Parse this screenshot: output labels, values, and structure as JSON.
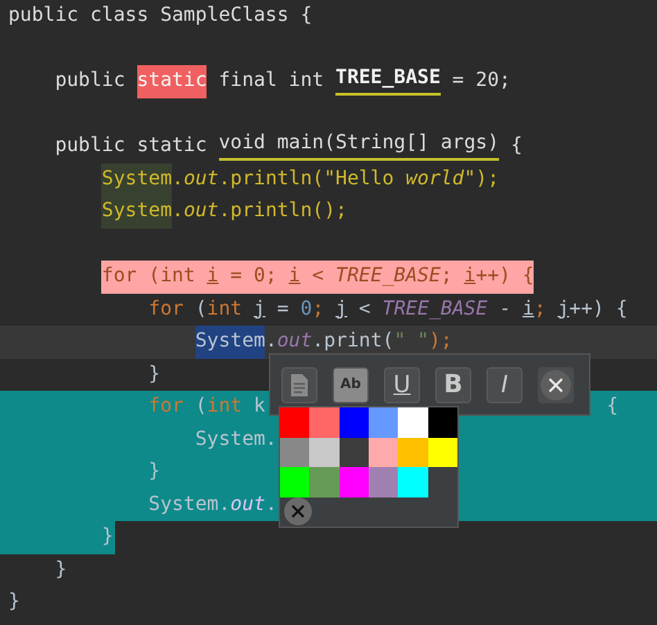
{
  "editor": {
    "lines": [
      {
        "kind": "code",
        "tokens": [
          {
            "text": "public class SampleClass {",
            "kind": "plain"
          }
        ],
        "children": [
          {
            "kind": "blank"
          },
          {
            "kind": "code",
            "tokens": [
              {
                "text": "public ",
                "kind": "plain"
              },
              {
                "text": "static",
                "kind": "redbox"
              },
              {
                "text": " final int ",
                "kind": "plain"
              },
              {
                "text": "TREE_BASE",
                "kind": "decl"
              },
              {
                "text": " = 20;",
                "kind": "plain"
              }
            ]
          },
          {
            "kind": "blank"
          },
          {
            "kind": "code",
            "tokens": [
              {
                "text": "public static ",
                "kind": "plain"
              },
              {
                "text": "void main(String[] args)",
                "kind": "under"
              },
              {
                "text": " {",
                "kind": "plain"
              }
            ],
            "children": [
              {
                "kind": "code",
                "tokens": [
                  {
                    "text": "System",
                    "kind": "ysys"
                  },
                  {
                    "text": ".",
                    "kind": "yellow"
                  },
                  {
                    "text": "out",
                    "kind": "yitalic"
                  },
                  {
                    "text": ".println(\"Hello ",
                    "kind": "yellow"
                  },
                  {
                    "text": "world",
                    "kind": "yitalic"
                  },
                  {
                    "text": "\");",
                    "kind": "yellow"
                  }
                ]
              },
              {
                "kind": "code",
                "tokens": [
                  {
                    "text": "System",
                    "kind": "ysys"
                  },
                  {
                    "text": ".",
                    "kind": "yellow"
                  },
                  {
                    "text": "out",
                    "kind": "yitalic"
                  },
                  {
                    "text": ".println();",
                    "kind": "yellow"
                  }
                ]
              },
              {
                "kind": "blank"
              },
              {
                "kind": "code",
                "marked": true,
                "tokens": [
                  {
                    "text": "for (int ",
                    "kind": "faded"
                  },
                  {
                    "text": "i",
                    "kind": "fadedu"
                  },
                  {
                    "text": " = 0; ",
                    "kind": "faded"
                  },
                  {
                    "text": "i",
                    "kind": "fadedu"
                  },
                  {
                    "text": " < ",
                    "kind": "faded"
                  },
                  {
                    "text": "TREE_BASE",
                    "kind": "fadedi"
                  },
                  {
                    "text": "; ",
                    "kind": "faded"
                  },
                  {
                    "text": "i",
                    "kind": "fadedu"
                  },
                  {
                    "text": "++) {",
                    "kind": "faded"
                  }
                ],
                "children": [
                  {
                    "kind": "code",
                    "tokens": [
                      {
                        "text": "for",
                        "kind": "kw"
                      },
                      {
                        "text": " (",
                        "kind": "text"
                      },
                      {
                        "text": "int ",
                        "kind": "kw"
                      },
                      {
                        "text": "j",
                        "kind": "var"
                      },
                      {
                        "text": " = ",
                        "kind": "text"
                      },
                      {
                        "text": "0",
                        "kind": "num"
                      },
                      {
                        "text": "; ",
                        "kind": "kw"
                      },
                      {
                        "text": "j",
                        "kind": "var"
                      },
                      {
                        "text": " < ",
                        "kind": "text"
                      },
                      {
                        "text": "TREE_BASE",
                        "kind": "const"
                      },
                      {
                        "text": " - ",
                        "kind": "text"
                      },
                      {
                        "text": "i",
                        "kind": "var"
                      },
                      {
                        "text": "; ",
                        "kind": "kw"
                      },
                      {
                        "text": "j",
                        "kind": "var"
                      },
                      {
                        "text": "++) {",
                        "kind": "text"
                      }
                    ],
                    "children": [
                      {
                        "kind": "code",
                        "current": true,
                        "tokens": [
                          {
                            "text": "System",
                            "kind": "selected"
                          },
                          {
                            "text": ".",
                            "kind": "text"
                          },
                          {
                            "text": "out",
                            "kind": "const"
                          },
                          {
                            "text": ".print(",
                            "kind": "text"
                          },
                          {
                            "text": "\" \"",
                            "kind": "str"
                          },
                          {
                            "text": ");",
                            "kind": "kw"
                          }
                        ]
                      }
                    ]
                  },
                  {
                    "kind": "code",
                    "tokens": [
                      {
                        "text": "}",
                        "kind": "text"
                      }
                    ]
                  },
                  {
                    "kind": "code",
                    "selected": true,
                    "tokens": [
                      {
                        "text": "for",
                        "kind": "kw"
                      },
                      {
                        "text": " (",
                        "kind": "text"
                      },
                      {
                        "text": "int ",
                        "kind": "kw"
                      },
                      {
                        "text": "k",
                        "kind": "text"
                      },
                      {
                        "text": "{",
                        "kind": "tail"
                      }
                    ],
                    "children": [
                      {
                        "kind": "code",
                        "selected": true,
                        "tokens": [
                          {
                            "text": "System.",
                            "kind": "text"
                          }
                        ]
                      }
                    ]
                  },
                  {
                    "kind": "code",
                    "selected": true,
                    "tokens": [
                      {
                        "text": "}",
                        "kind": "text"
                      }
                    ]
                  },
                  {
                    "kind": "code",
                    "selected": true,
                    "tokens": [
                      {
                        "text": "System.",
                        "kind": "text"
                      },
                      {
                        "text": "out",
                        "kind": "const"
                      },
                      {
                        "text": ".",
                        "kind": "text"
                      }
                    ]
                  }
                ]
              },
              {
                "kind": "code",
                "selected": true,
                "tokens": [
                  {
                    "text": "}",
                    "kind": "text"
                  }
                ]
              }
            ]
          },
          {
            "kind": "code",
            "tokens": [
              {
                "text": "}",
                "kind": "text"
              }
            ]
          }
        ]
      },
      {
        "kind": "code",
        "tokens": [
          {
            "text": "}",
            "kind": "text"
          }
        ]
      }
    ]
  },
  "popup": {
    "tools": [
      {
        "kind": "copy"
      },
      {
        "kind": "text",
        "label": "Ab"
      },
      {
        "kind": "underline",
        "label": "U"
      },
      {
        "kind": "bold",
        "label": "B"
      },
      {
        "kind": "italic",
        "label": "I"
      },
      {
        "kind": "close"
      }
    ],
    "swatches": [
      {
        "color": "#ff0000"
      },
      {
        "color": "#ff6666"
      },
      {
        "color": "#0000ff"
      },
      {
        "color": "#6699ff"
      },
      {
        "color": "#ffffff"
      },
      {
        "color": "#000000"
      },
      {
        "color": "#888888"
      },
      {
        "color": "#c8c8c8"
      },
      {
        "color": "#3c3c3c"
      },
      {
        "color": "#ffaaaa"
      },
      {
        "color": "#ffc000"
      },
      {
        "color": "#ffff00"
      },
      {
        "color": "#00ff00"
      },
      {
        "color": "#669955"
      },
      {
        "color": "#ff00ff"
      },
      {
        "color": "#a080b0"
      },
      {
        "color": "#00ffff"
      }
    ]
  }
}
